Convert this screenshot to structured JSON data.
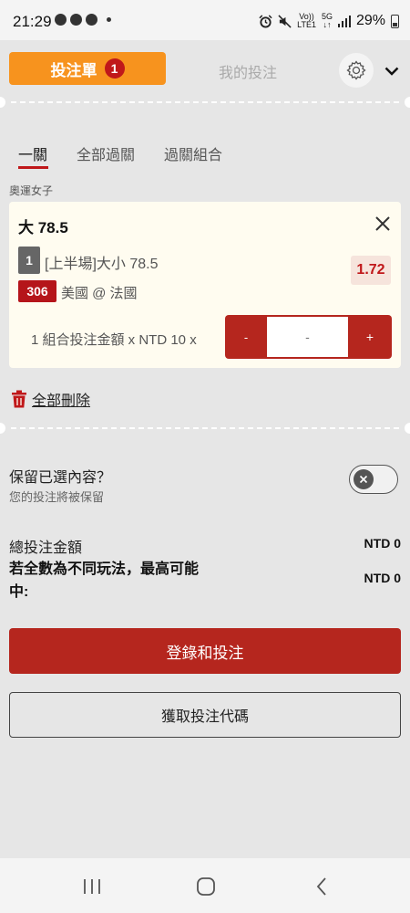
{
  "status_bar": {
    "time": "21:29",
    "network_top": "Vo))",
    "network_bottom": "LTE1",
    "fiveg_top": "5G",
    "fiveg_bottom": "↓↑",
    "battery": "29%"
  },
  "header": {
    "bet_slip_label": "投注單",
    "bet_slip_count": "1",
    "my_bets_label": "我的投注",
    "colors": {
      "tab_active_bg": "#f7931e",
      "badge_bg": "#c0181a"
    }
  },
  "subtabs": [
    "一關",
    "全部過關",
    "過關組合"
  ],
  "league": "奧運女子",
  "bet": {
    "title": "大 78.5",
    "market_index": "1",
    "market": "[上半場]大小 78.5",
    "odds": "1.72",
    "match_id": "306",
    "match": "美國 @ 法國",
    "stake_label": "1 組合投注金額 x NTD 10 x",
    "minus_label": "-",
    "input_placeholder": "-",
    "plus_label": "+"
  },
  "delete_all_label": "全部刪除",
  "keep_selection": {
    "title": "保留已選內容？",
    "subtitle": "您的投注將被保留",
    "enabled": false
  },
  "summary": {
    "total_label": "總投注金額",
    "total_value": "NTD 0",
    "max_win_label": "若全數為不同玩法，最高可能中:",
    "max_win_value": "NTD 0"
  },
  "buttons": {
    "login_bet": "登錄和投注",
    "get_code": "獲取投注代碼"
  },
  "colors": {
    "accent_red": "#b5261e",
    "background": "#e6e6e6",
    "card_bg": "#fffcf0"
  }
}
